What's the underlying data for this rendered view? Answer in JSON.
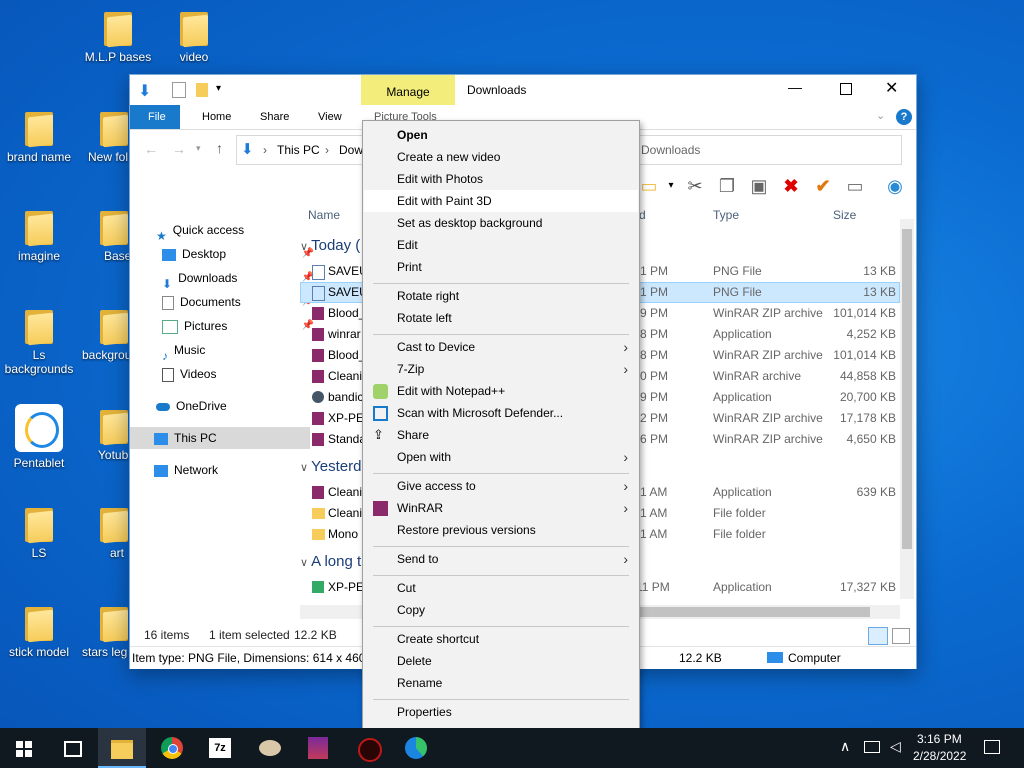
{
  "desktop": {
    "icons": [
      {
        "label": "M.L.P bases"
      },
      {
        "label": "video"
      },
      {
        "label": "brand name"
      },
      {
        "label": "New fol"
      },
      {
        "label": "imagine"
      },
      {
        "label": "Base"
      },
      {
        "label": "Ls backgrounds"
      },
      {
        "label": "backgrou"
      },
      {
        "label": "Pentablet"
      },
      {
        "label": "Yotub"
      },
      {
        "label": "LS"
      },
      {
        "label": "art"
      },
      {
        "label": "stick model"
      },
      {
        "label": "stars leg"
      }
    ]
  },
  "window": {
    "title": "Downloads",
    "manage_tab": "Manage",
    "picture_tools": "Picture Tools",
    "tabs": [
      "File",
      "Home",
      "Share",
      "View"
    ],
    "breadcrumb": [
      "This PC",
      "Dow"
    ],
    "search_placeholder": "Downloads",
    "columns": {
      "name": "Name",
      "type": "Type",
      "size": "Size",
      "date_partial": "d"
    },
    "groups": [
      {
        "label": "Today ("
      },
      {
        "label": "Yesterda"
      },
      {
        "label": "A long t"
      }
    ],
    "nav": [
      {
        "label": "Quick access"
      },
      {
        "label": "Desktop"
      },
      {
        "label": "Downloads"
      },
      {
        "label": "Documents"
      },
      {
        "label": "Pictures"
      },
      {
        "label": "Music"
      },
      {
        "label": "Videos"
      },
      {
        "label": "OneDrive"
      },
      {
        "label": "This PC"
      },
      {
        "label": "Network"
      }
    ],
    "files": [
      {
        "name": "SAVEU",
        "time": "1 PM",
        "type": "PNG File",
        "size": "13 KB"
      },
      {
        "name": "SAVEU",
        "time": "1 PM",
        "type": "PNG File",
        "size": "13 KB"
      },
      {
        "name": "Blood_",
        "time": "9 PM",
        "type": "WinRAR ZIP archive",
        "size": "101,014 KB"
      },
      {
        "name": "winrar",
        "time": "8 PM",
        "type": "Application",
        "size": "4,252 KB"
      },
      {
        "name": "Blood_",
        "time": "8 PM",
        "type": "WinRAR ZIP archive",
        "size": "101,014 KB"
      },
      {
        "name": "Cleani",
        "time": "0 PM",
        "type": "WinRAR archive",
        "size": "44,858 KB"
      },
      {
        "name": "bandic",
        "time": "9 PM",
        "type": "Application",
        "size": "20,700 KB"
      },
      {
        "name": "XP-PE",
        "time": "2 PM",
        "type": "WinRAR ZIP archive",
        "size": "17,178 KB"
      },
      {
        "name": "Standa",
        "time": "6 PM",
        "type": "WinRAR ZIP archive",
        "size": "4,650 KB"
      },
      {
        "name": "Cleani",
        "time": "1 AM",
        "type": "Application",
        "size": "639 KB"
      },
      {
        "name": "Cleani",
        "time": "1 AM",
        "type": "File folder",
        "size": ""
      },
      {
        "name": "Mono",
        "time": "1 AM",
        "type": "File folder",
        "size": ""
      },
      {
        "name": "XP-PE",
        "time": "11 PM",
        "type": "Application",
        "size": "17,327 KB"
      }
    ],
    "status": {
      "count": "16 items",
      "selected": "1 item selected",
      "selsize": "12.2 KB"
    },
    "details": {
      "itemtype": "Item type: PNG File, Dimensions: 614 x 460,",
      "size": "12.2 KB",
      "location": "Computer"
    }
  },
  "context_menu": {
    "items": [
      {
        "label": "Open"
      },
      {
        "label": "Create a new video"
      },
      {
        "label": "Edit with Photos"
      },
      {
        "label": "Edit with Paint 3D"
      },
      {
        "label": "Set as desktop background"
      },
      {
        "label": "Edit"
      },
      {
        "label": "Print"
      },
      {
        "label": "Rotate right"
      },
      {
        "label": "Rotate left"
      },
      {
        "label": "Cast to Device"
      },
      {
        "label": "7-Zip"
      },
      {
        "label": "Edit with Notepad++"
      },
      {
        "label": "Scan with Microsoft Defender..."
      },
      {
        "label": "Share"
      },
      {
        "label": "Open with"
      },
      {
        "label": "Give access to"
      },
      {
        "label": "WinRAR"
      },
      {
        "label": "Restore previous versions"
      },
      {
        "label": "Send to"
      },
      {
        "label": "Cut"
      },
      {
        "label": "Copy"
      },
      {
        "label": "Create shortcut"
      },
      {
        "label": "Delete"
      },
      {
        "label": "Rename"
      },
      {
        "label": "Properties"
      }
    ]
  },
  "taskbar": {
    "time": "3:16 PM",
    "date": "2/28/2022"
  },
  "colors": {
    "accent": "#1979ca",
    "manage": "#f3ed7b",
    "selection": "#cce8ff",
    "taskbar": "#101820"
  }
}
